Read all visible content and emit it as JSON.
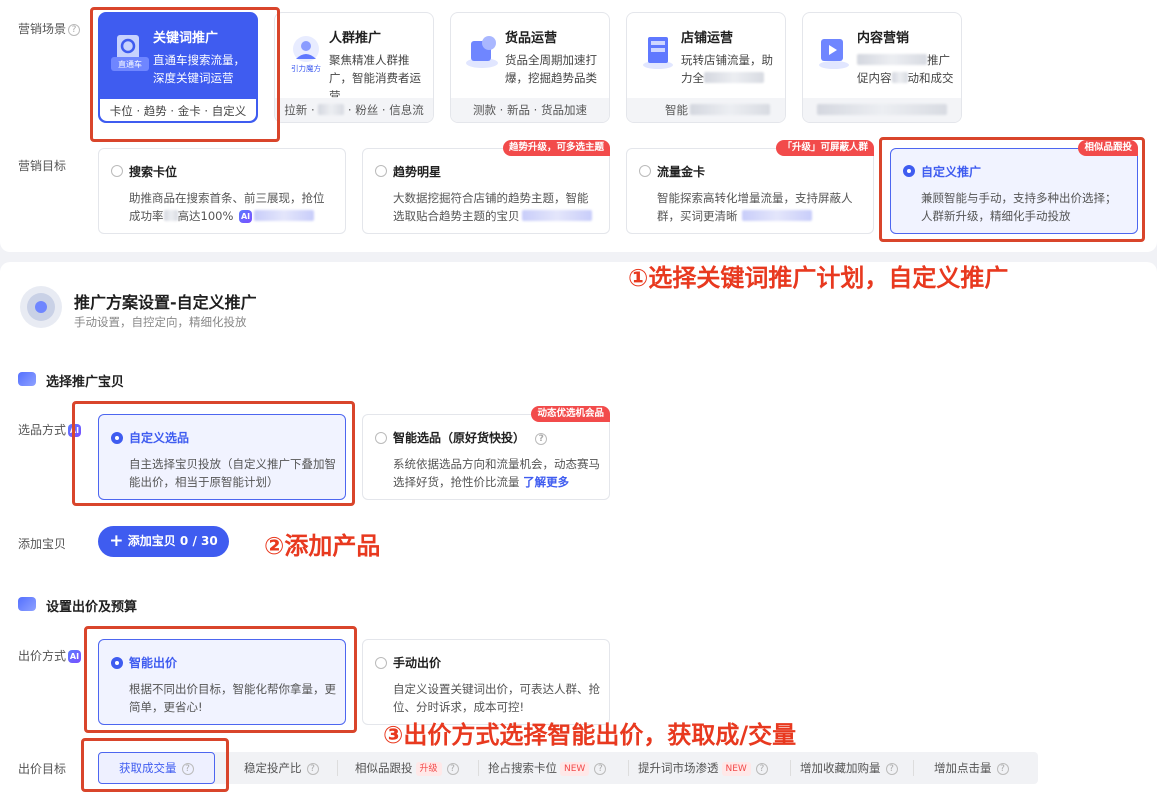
{
  "scene": {
    "label": "营销场景",
    "cards": [
      {
        "title": "关键词推广",
        "desc": "直通车搜索流量，深度关键词运营",
        "foot": "卡位 · 趋势 · 金卡 · 自定义",
        "icon": "直通车",
        "active": true
      },
      {
        "title": "人群推广",
        "desc": "聚焦精准人群推广，智能消费者运营",
        "foot": "拉新 ·      · 粉丝 · 信息流",
        "icon": "引力魔方"
      },
      {
        "title": "货品运营",
        "desc": "货品全周期加速打爆，挖掘趋势品类",
        "foot": "测款 · 新品 · 货品加速",
        "icon": ""
      },
      {
        "title": "店铺运营",
        "desc": "玩转店铺流量，助力全",
        "foot": "智能",
        "icon": ""
      },
      {
        "title": "内容营销",
        "desc": "推广促内容 动和成交",
        "foot": "",
        "icon": ""
      }
    ]
  },
  "goal": {
    "label": "营销目标",
    "cards": [
      {
        "title": "搜索卡位",
        "desc1": "助推商品在搜索首条、前三展现，抢位",
        "desc2": "成功率  高达100%",
        "tag": ""
      },
      {
        "title": "趋势明星",
        "desc1": "大数据挖掘符合店铺的趋势主题，智能",
        "desc2": "选取贴合趋势主题的宝贝",
        "tag": "趋势升级，可多选主题"
      },
      {
        "title": "流量金卡",
        "desc1": "智能探索高转化增量流量，支持屏蔽人",
        "desc2": "群，买词更清晰",
        "tag": "「升级」可屏蔽人群"
      },
      {
        "title": "自定义推广",
        "desc1": "兼顾智能与手动，支持多种出价选择；",
        "desc2": "人群新升级，精细化手动投放",
        "tag": "相似品跟投"
      }
    ]
  },
  "annotations": {
    "a1": "①选择关键词推广计划，自定义推广",
    "a2": "②添加产品",
    "a3": "③出价方式选择智能出价，获取成/交量"
  },
  "plan": {
    "title": "推广方案设置-自定义推广",
    "subtitle": "手动设置，自控定向，精细化投放"
  },
  "select_section": {
    "title": "选择推广宝贝",
    "method_label": "选品方式",
    "options": [
      {
        "title": "自定义选品",
        "desc": "自主选择宝贝投放（自定义推广下叠加智能出价，相当于原智能计划）"
      },
      {
        "title": "智能选品（原好货快投）",
        "desc": "系统依据选品方向和流量机会，动态赛马选择好货，抢性价比流量",
        "link": "了解更多",
        "tag": "动态优选机会品"
      }
    ],
    "add_label": "添加宝贝",
    "add_button": "添加宝贝 0 / 30"
  },
  "bid_section": {
    "title": "设置出价及预算",
    "method_label": "出价方式",
    "options": [
      {
        "title": "智能出价",
        "desc": "根据不同出价目标，智能化帮你拿量，更简单，更省心!"
      },
      {
        "title": "手动出价",
        "desc": "自定义设置关键词出价，可表达人群、抢位、分时诉求，成本可控!"
      }
    ],
    "target_label": "出价目标",
    "targets": [
      {
        "label": "获取成交量"
      },
      {
        "label": "稳定投产比"
      },
      {
        "label": "相似品跟投",
        "tag": "升级"
      },
      {
        "label": "抢占搜索卡位",
        "tag": "NEW"
      },
      {
        "label": "提升词市场渗透",
        "tag": "NEW"
      },
      {
        "label": "增加收藏加购量"
      },
      {
        "label": "增加点击量"
      }
    ]
  },
  "colors": {
    "accent": "#3f5cf0",
    "annotation": "#e8391f",
    "tag_red": "#f24b4b"
  }
}
